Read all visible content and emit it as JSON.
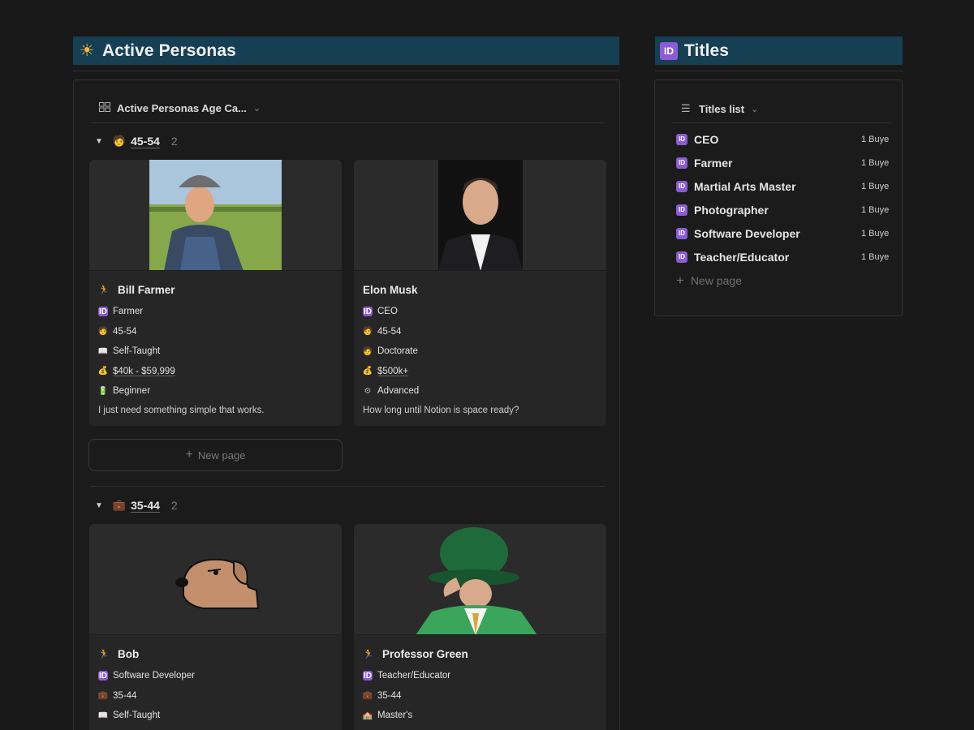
{
  "left_header": {
    "emoji": "☀",
    "title": "Active Personas"
  },
  "right_header": {
    "badge": "ID",
    "title": "Titles"
  },
  "board": {
    "view_label": "Active Personas Age Ca...",
    "new_page_label": "New page",
    "groups": [
      {
        "label": "45-54",
        "count": "2",
        "cards": [
          {
            "name": "Bill Farmer",
            "title": "Farmer",
            "age": "45-54",
            "education": "Self-Taught",
            "income": "$40k - $59,999",
            "skill": "Beginner",
            "quote": "I just need something simple that works."
          },
          {
            "name": "Elon Musk",
            "title": "CEO",
            "age": "45-54",
            "education": "Doctorate",
            "income": "$500k+",
            "skill": "Advanced",
            "quote": "How long until Notion is space ready?"
          }
        ]
      },
      {
        "label": "35-44",
        "count": "2",
        "cards": [
          {
            "name": "Bob",
            "title": "Software Developer",
            "age": "35-44",
            "education": "Self-Taught"
          },
          {
            "name": "Professor Green",
            "title": "Teacher/Educator",
            "age": "35-44",
            "education": "Master's"
          }
        ]
      }
    ]
  },
  "titles": {
    "view_label": "Titles list",
    "new_page_label": "New page",
    "items": [
      {
        "name": "CEO",
        "count": "1 Buye"
      },
      {
        "name": "Farmer",
        "count": "1 Buye"
      },
      {
        "name": "Martial Arts Master",
        "count": "1 Buye"
      },
      {
        "name": "Photographer",
        "count": "1 Buye"
      },
      {
        "name": "Software Developer",
        "count": "1 Buye"
      },
      {
        "name": "Teacher/Educator",
        "count": "1 Buye"
      }
    ]
  },
  "colors": {
    "header_bg": "#163f54",
    "id_badge": "#8c5bd6",
    "page_bg": "#191919",
    "card_bg": "#262626"
  }
}
